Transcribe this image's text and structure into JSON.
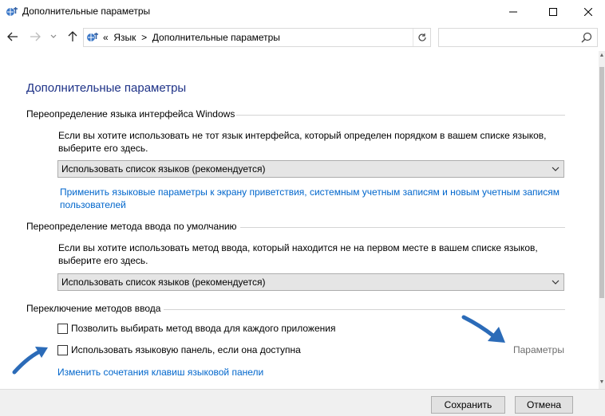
{
  "window": {
    "title": "Дополнительные параметры",
    "controls": {
      "minimize": "—",
      "maximize": "☐",
      "close": "✕"
    }
  },
  "nav": {
    "back_icon": "arrow-left-icon",
    "forward_icon": "arrow-right-icon",
    "recent_icon": "chevron-down-icon",
    "up_icon": "arrow-up-icon",
    "breadcrumb_prefix": "«",
    "breadcrumb": [
      "Язык",
      "Дополнительные параметры"
    ],
    "breadcrumb_sep": ">",
    "search_placeholder": ""
  },
  "main": {
    "title": "Дополнительные параметры",
    "ui_language": {
      "heading": "Переопределение языка интерфейса Windows",
      "description": "Если вы хотите использовать не тот язык интерфейса, который определен порядком в вашем списке языков, выберите его здесь.",
      "select_value": "Использовать список языков (рекомендуется)",
      "link": "Применить языковые параметры к экрану приветствия, системным учетным записям и новым учетным записям пользователей"
    },
    "input_method": {
      "heading": "Переопределение метода ввода по умолчанию",
      "description": "Если вы хотите использовать метод ввода, который находится не на первом месте в вашем списке языков, выберите его здесь.",
      "select_value": "Использовать список языков (рекомендуется)"
    },
    "switching": {
      "heading": "Переключение методов ввода",
      "options": [
        {
          "label": "Позволить выбирать метод ввода для каждого приложения",
          "checked": false
        },
        {
          "label": "Использовать языковую панель, если она доступна",
          "checked": false
        }
      ],
      "params_link": "Параметры",
      "hotkeys_link": "Изменить сочетания клавиш языковой панели"
    }
  },
  "footer": {
    "save": "Сохранить",
    "cancel": "Отмена"
  },
  "colors": {
    "title_blue": "#1e3287",
    "link_blue": "#0066cc",
    "arrow_blue": "#2b6bb8"
  }
}
